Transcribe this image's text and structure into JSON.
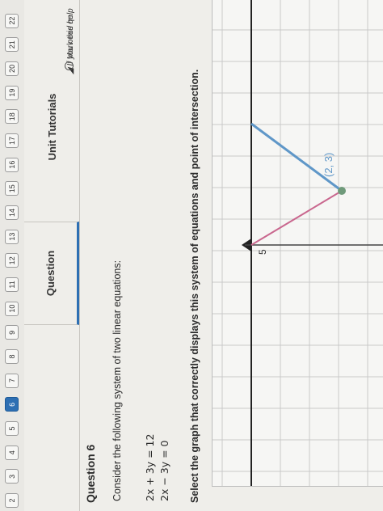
{
  "nav": {
    "question_numbers": [
      "2",
      "3",
      "4",
      "5",
      "6",
      "7",
      "8",
      "9",
      "10",
      "11",
      "12",
      "13",
      "14",
      "15",
      "16",
      "17",
      "18",
      "19",
      "20",
      "21",
      "22"
    ],
    "active": "6"
  },
  "tabs": {
    "question": "Question",
    "tutorials": "Unit Tutorials"
  },
  "help_text": "If you need help",
  "mark_review": "Mark this qu",
  "question": {
    "title": "Question 6",
    "intro": "Consider the following system of two linear equations:",
    "equations": [
      "2x + 3y = 12",
      "2x − 3y = 0"
    ],
    "prompt": "Select the graph that correctly displays this system of equations and point of intersection."
  },
  "graph": {
    "axis_label_y": "5",
    "intersection_label": "(2, 3)",
    "colors": {
      "line_pink": "#c9678e",
      "line_blue": "#5f97c8",
      "point": "#6f9a7a",
      "grid": "#c9c9c9"
    }
  }
}
